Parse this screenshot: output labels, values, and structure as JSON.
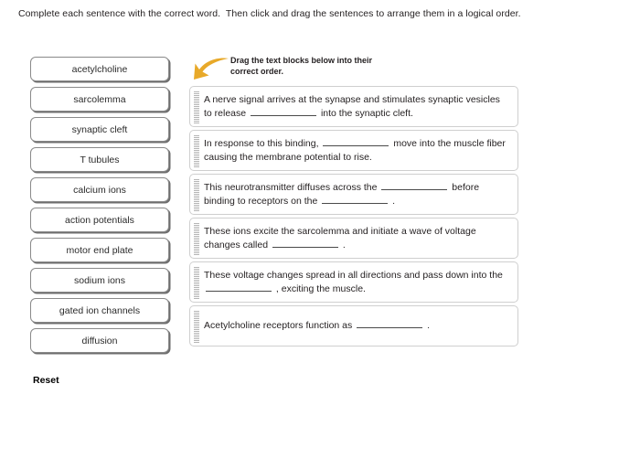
{
  "page": {
    "instruction": "Complete each sentence with the correct word.  Then click and drag the sentences to arrange them in a logical order.",
    "reset_label": "Reset",
    "background_color": "#ffffff",
    "text_color": "#231f20"
  },
  "word_bank": {
    "items": [
      {
        "label": "acetylcholine"
      },
      {
        "label": "sarcolemma"
      },
      {
        "label": "synaptic cleft"
      },
      {
        "label": "T tubules"
      },
      {
        "label": "calcium ions"
      },
      {
        "label": "action potentials"
      },
      {
        "label": "motor end plate"
      },
      {
        "label": "sodium ions"
      },
      {
        "label": "gated ion channels"
      },
      {
        "label": "diffusion"
      }
    ]
  },
  "drop_panel": {
    "hint": {
      "line1": "Drag the text blocks below into their",
      "line2": "correct order.",
      "arrow_icon": "curved-arrow-down-left-icon",
      "arrow_color": "#e8a929"
    },
    "grip_icon": "drag-grip-icon",
    "sentences": [
      {
        "id": "sentence-1",
        "parts": [
          {
            "type": "text",
            "value": "A nerve signal arrives at the synapse and stimulates synaptic vesicles to release "
          },
          {
            "type": "blank"
          },
          {
            "type": "text",
            "value": " into the synaptic cleft."
          }
        ]
      },
      {
        "id": "sentence-2",
        "parts": [
          {
            "type": "text",
            "value": "In response to this binding, "
          },
          {
            "type": "blank"
          },
          {
            "type": "text",
            "value": " move into the muscle fiber causing the membrane potential to rise."
          }
        ]
      },
      {
        "id": "sentence-3",
        "parts": [
          {
            "type": "text",
            "value": "This neurotransmitter diffuses across the "
          },
          {
            "type": "blank"
          },
          {
            "type": "text",
            "value": " before binding to receptors on the "
          },
          {
            "type": "blank"
          },
          {
            "type": "text",
            "value": " ."
          }
        ]
      },
      {
        "id": "sentence-4",
        "parts": [
          {
            "type": "text",
            "value": "These ions excite the sarcolemma and initiate a wave of voltage changes called "
          },
          {
            "type": "blank"
          },
          {
            "type": "text",
            "value": " ."
          }
        ]
      },
      {
        "id": "sentence-5",
        "parts": [
          {
            "type": "text",
            "value": "These voltage changes spread in all directions and pass down into the "
          },
          {
            "type": "blank"
          },
          {
            "type": "text",
            "value": " , exciting the muscle."
          }
        ]
      },
      {
        "id": "sentence-6",
        "parts": [
          {
            "type": "text",
            "value": "Acetylcholine receptors function as "
          },
          {
            "type": "blank"
          },
          {
            "type": "text",
            "value": " ."
          }
        ]
      }
    ]
  }
}
